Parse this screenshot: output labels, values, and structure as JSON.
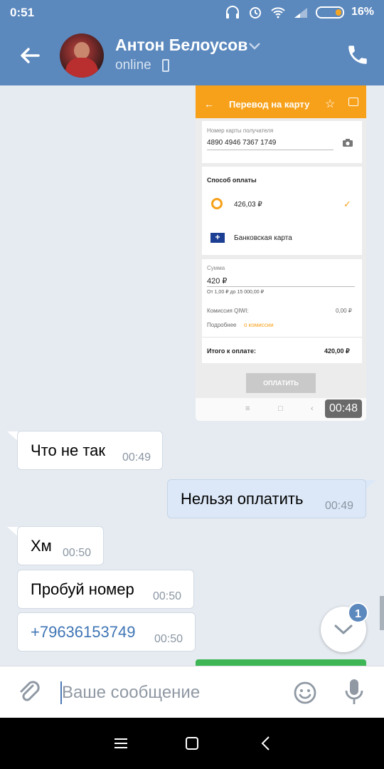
{
  "status_bar": {
    "time": "0:51",
    "battery": "16%"
  },
  "header": {
    "name": "Антон Белоусов",
    "status": "online"
  },
  "screenshot": {
    "title": "Перевод на карту",
    "card_number_label": "Номер карты получателя",
    "card_number": "4890 4946 7367 1749",
    "payment_method_label": "Способ оплаты",
    "qiwi_balance": "426,03 ₽",
    "bank_card": "Банковская карта",
    "amount_label": "Сумма",
    "amount": "420 ₽",
    "amount_hint": "От 1,00 ₽ до 15 000,00 ₽",
    "commission_label": "Комиссия QIWI:",
    "commission_value": "0,00 ₽",
    "more_label": "Подробнее",
    "more_link": "о комиссии",
    "total_label": "Итого к оплате:",
    "total_value": "420,00 ₽",
    "pay_button": "ОПЛАТИТЬ",
    "time": "00:48"
  },
  "messages": [
    {
      "text": "Что не так",
      "time": "00:49",
      "direction": "in"
    },
    {
      "text": "Нельзя оплатить",
      "time": "00:49",
      "direction": "out"
    },
    {
      "text": "Хм",
      "time": "00:50",
      "direction": "in"
    },
    {
      "text": "Пробуй номер",
      "time": "00:50",
      "direction": "in"
    },
    {
      "text": "+79636153749",
      "time": "00:50",
      "direction": "in"
    }
  ],
  "unread_badge": "1",
  "input": {
    "placeholder": "Ваше сообщение"
  },
  "colors": {
    "header": "#5b88bd",
    "outgoing": "#dce8f7",
    "qiwi_accent": "#f7a11b"
  }
}
